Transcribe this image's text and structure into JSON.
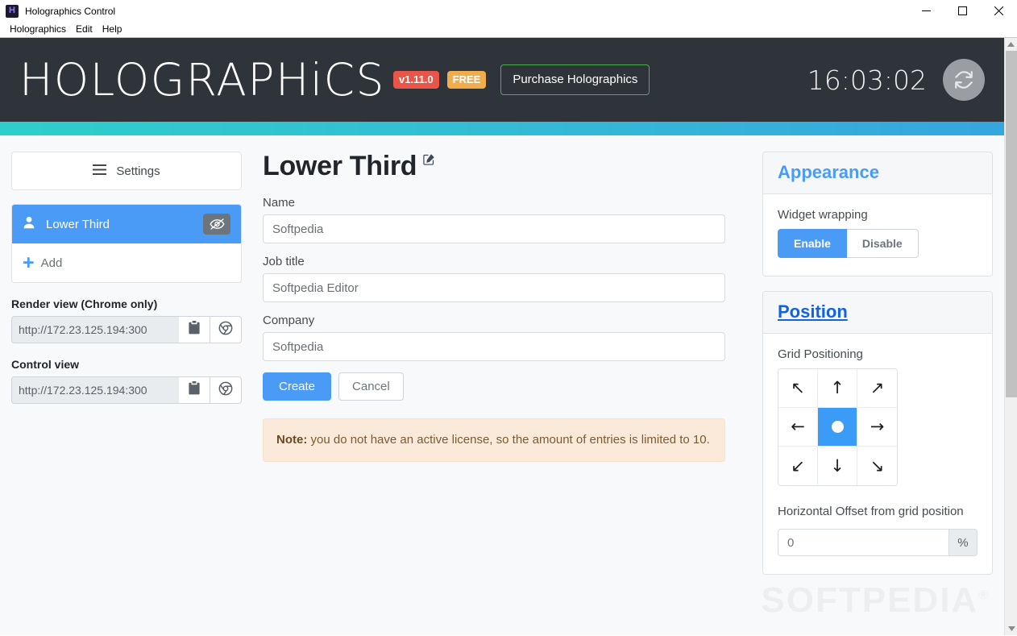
{
  "window": {
    "title": "Holographics Control",
    "app_icon": "H",
    "controls": [
      {
        "name": "minimize",
        "glyph": "minimize-icon"
      },
      {
        "name": "maximize",
        "glyph": "maximize-icon"
      },
      {
        "name": "close",
        "glyph": "close-icon"
      }
    ],
    "menu": [
      "Holographics",
      "Edit",
      "Help"
    ]
  },
  "header": {
    "logo": "HOLOGRAPHiCS",
    "version_badge": "v1.11.0",
    "free_badge": "FREE",
    "purchase_label": "Purchase Holographics",
    "clock": "16:03:02",
    "refresh_icon": "refresh-icon",
    "colors": {
      "background": "#2f343b",
      "version_badge": "#e8564a",
      "free_badge": "#f0ad4e",
      "purchase_border": "#4caf50",
      "accent_bar_start": "#2ecfca",
      "accent_bar_end": "#35a6de"
    }
  },
  "sidebar": {
    "settings_label": "Settings",
    "settings_icon": "hamburger-icon",
    "widgets": [
      {
        "label": "Lower Third",
        "icon": "user-icon",
        "active": true,
        "toggle_icon": "eye-slash-icon"
      }
    ],
    "add_label": "Add",
    "add_icon": "plus-icon",
    "render_view": {
      "title": "Render view (Chrome only)",
      "url": "http://172.23.125.194:300",
      "copy_icon": "clipboard-icon",
      "open_icon": "chrome-icon"
    },
    "control_view": {
      "title": "Control view",
      "url": "http://172.23.125.194:300",
      "copy_icon": "clipboard-icon",
      "open_icon": "chrome-icon"
    }
  },
  "main": {
    "title": "Lower Third",
    "edit_icon": "edit-square-icon",
    "fields": [
      {
        "label": "Name",
        "value": "Softpedia",
        "placeholder": "Softpedia"
      },
      {
        "label": "Job title",
        "value": "Softpedia Editor",
        "placeholder": "Softpedia Editor"
      },
      {
        "label": "Company",
        "value": "Softpedia",
        "placeholder": "Softpedia"
      }
    ],
    "create_label": "Create",
    "cancel_label": "Cancel",
    "note": {
      "prefix": "Note:",
      "text": " you do not have an active license, so the amount of entries is limited to 10."
    }
  },
  "appearance": {
    "heading": "Appearance",
    "widget_wrapping_label": "Widget wrapping",
    "enable_label": "Enable",
    "disable_label": "Disable",
    "selected": "Enable"
  },
  "position": {
    "heading": "Position",
    "grid_label": "Grid Positioning",
    "grid_cells": [
      {
        "name": "top-left",
        "glyph": "↖"
      },
      {
        "name": "top-center",
        "glyph": "↑"
      },
      {
        "name": "top-right",
        "glyph": "↗"
      },
      {
        "name": "middle-left",
        "glyph": "←"
      },
      {
        "name": "center",
        "glyph": "●",
        "active": true
      },
      {
        "name": "middle-right",
        "glyph": "→"
      },
      {
        "name": "bottom-left",
        "glyph": "↙"
      },
      {
        "name": "bottom-center",
        "glyph": "↓"
      },
      {
        "name": "bottom-right",
        "glyph": "↘"
      }
    ],
    "offset_label": "Horizontal Offset from grid position",
    "offset_value": "0",
    "offset_placeholder": "0",
    "offset_unit": "%"
  },
  "watermark": "SOFTPEDIA"
}
